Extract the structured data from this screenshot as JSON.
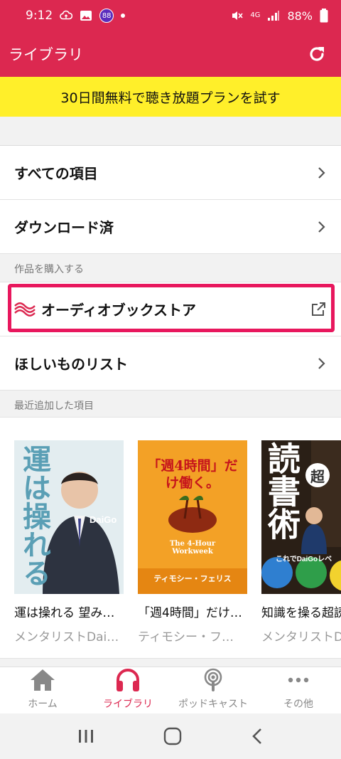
{
  "status_bar": {
    "time": "9:12",
    "notification_count": "88",
    "network": "4G",
    "battery": "88%"
  },
  "app_bar": {
    "title": "ライブラリ",
    "refresh_icon": "refresh-icon"
  },
  "promo": {
    "text": "30日間無料で聴き放題プランを試す"
  },
  "library": {
    "all_items": "すべての項目",
    "downloaded": "ダウンロード済"
  },
  "purchase_section": {
    "label": "作品を購入する",
    "store": "オーディオブックストア",
    "wishlist": "ほしいものリスト"
  },
  "recent_section": {
    "label": "最近追加した項目",
    "books": [
      {
        "title": "運は操れる 望み…",
        "author": "メンタリストDai…",
        "cover_text": "運は操れる",
        "cover_author": "DaiGo"
      },
      {
        "title": "「週4時間」だけ…",
        "author": "ティモシー・フ…",
        "cover_text": "「週4時間」だけ働く。",
        "cover_sub": "The 4-Hour Workweek",
        "cover_author": "ティモシー・フェリス"
      },
      {
        "title": "知識を操る超読…",
        "author": "メンタリストD…",
        "cover_text": "読書術",
        "cover_sub": "超",
        "cover_author": "これでDaiGoレベ"
      }
    ]
  },
  "tabs": [
    {
      "label": "ホーム",
      "icon": "home-icon"
    },
    {
      "label": "ライブラリ",
      "icon": "headphones-icon"
    },
    {
      "label": "ポッドキャスト",
      "icon": "podcast-icon"
    },
    {
      "label": "その他",
      "icon": "more-icon"
    }
  ],
  "colors": {
    "brand": "#dc2850",
    "promo": "#ffef2a",
    "highlight": "#e8175d"
  }
}
